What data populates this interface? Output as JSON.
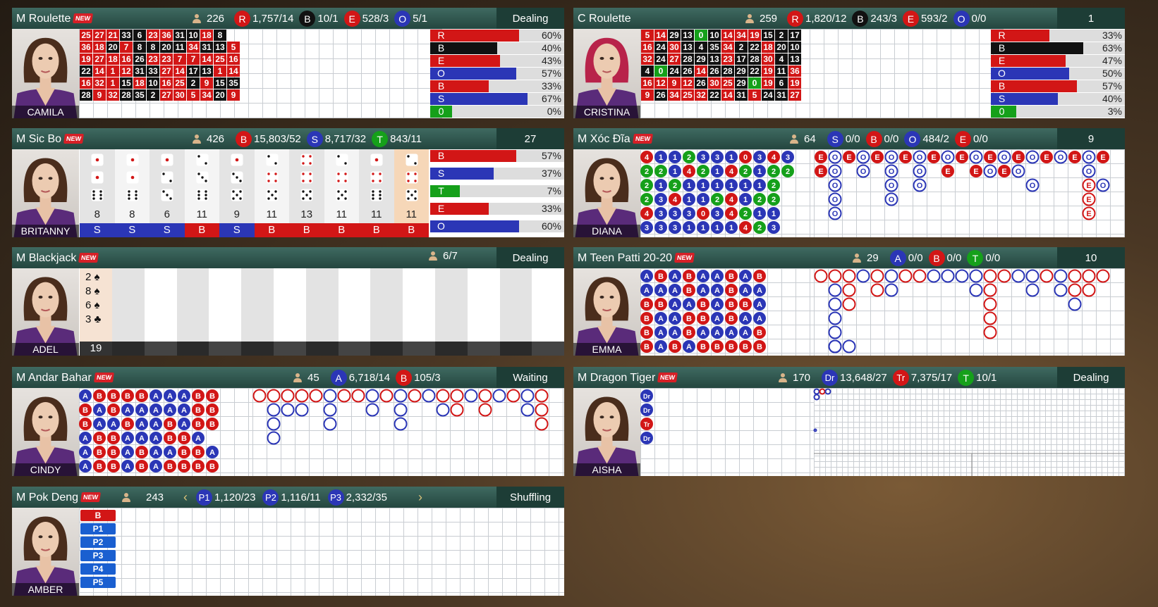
{
  "colors": {
    "red": "#d21616",
    "blue": "#2b36b6",
    "green": "#15a01a",
    "black": "#111111",
    "teal": "#2e5a52",
    "status_bg": "#1d3d36"
  },
  "roulette_m": {
    "title": "M Roulette",
    "new": "NEW",
    "players": "226",
    "badges": [
      {
        "l": "R",
        "v": "1,757/14",
        "c": "red"
      },
      {
        "l": "B",
        "v": "10/1",
        "c": "black"
      },
      {
        "l": "E",
        "v": "528/3",
        "c": "red"
      },
      {
        "l": "O",
        "v": "5/1",
        "c": "blue"
      }
    ],
    "status": "Dealing",
    "dealer": "CAMILA",
    "numbers": [
      [
        "25",
        "27",
        "21",
        "33",
        "6",
        "23",
        "36",
        "31",
        "10",
        "18",
        "8"
      ],
      [
        "36",
        "18",
        "20",
        "7",
        "8",
        "8",
        "20",
        "11",
        "34",
        "31",
        "13",
        "5"
      ],
      [
        "19",
        "27",
        "18",
        "16",
        "26",
        "23",
        "23",
        "7",
        "7",
        "14",
        "25",
        "16"
      ],
      [
        "22",
        "14",
        "1",
        "12",
        "31",
        "33",
        "27",
        "14",
        "17",
        "13",
        "1",
        "14"
      ],
      [
        "16",
        "32",
        "1",
        "15",
        "18",
        "10",
        "16",
        "25",
        "2",
        "9",
        "15",
        "35"
      ],
      [
        "28",
        "9",
        "32",
        "28",
        "35",
        "2",
        "27",
        "30",
        "5",
        "34",
        "20",
        "9"
      ]
    ],
    "bars": [
      {
        "l": "R",
        "p": "60%",
        "f": 60,
        "c": "red"
      },
      {
        "l": "B",
        "p": "40%",
        "f": 40,
        "c": "black"
      },
      {
        "l": "E",
        "p": "43%",
        "f": 43,
        "c": "red"
      },
      {
        "l": "O",
        "p": "57%",
        "f": 57,
        "c": "blue"
      },
      {
        "l": "B",
        "p": "33%",
        "f": 33,
        "c": "red"
      },
      {
        "l": "S",
        "p": "67%",
        "f": 67,
        "c": "blue"
      },
      {
        "l": "0",
        "p": "0%",
        "f": 0,
        "c": "green"
      }
    ]
  },
  "roulette_c": {
    "title": "C Roulette",
    "players": "259",
    "badges": [
      {
        "l": "R",
        "v": "1,820/12",
        "c": "red"
      },
      {
        "l": "B",
        "v": "243/3",
        "c": "black"
      },
      {
        "l": "E",
        "v": "593/2",
        "c": "red"
      },
      {
        "l": "O",
        "v": "0/0",
        "c": "blue"
      }
    ],
    "status": "1",
    "dealer": "CRISTINA",
    "numbers": [
      [
        "5",
        "14",
        "29",
        "13",
        "0",
        "10",
        "14",
        "34",
        "19",
        "15",
        "2",
        "17"
      ],
      [
        "16",
        "24",
        "30",
        "13",
        "4",
        "35",
        "34",
        "2",
        "22",
        "18",
        "20",
        "10"
      ],
      [
        "32",
        "24",
        "27",
        "28",
        "29",
        "13",
        "23",
        "17",
        "28",
        "30",
        "4",
        "13"
      ],
      [
        "4",
        "0",
        "24",
        "26",
        "14",
        "26",
        "28",
        "29",
        "22",
        "19",
        "11",
        "36"
      ],
      [
        "16",
        "12",
        "9",
        "12",
        "26",
        "30",
        "25",
        "29",
        "0",
        "19",
        "6",
        "19"
      ],
      [
        "9",
        "26",
        "34",
        "25",
        "32",
        "22",
        "14",
        "31",
        "5",
        "24",
        "31",
        "27"
      ]
    ],
    "bars": [
      {
        "l": "R",
        "p": "33%",
        "f": 33,
        "c": "red"
      },
      {
        "l": "B",
        "p": "63%",
        "f": 63,
        "c": "black"
      },
      {
        "l": "E",
        "p": "47%",
        "f": 47,
        "c": "red"
      },
      {
        "l": "O",
        "p": "50%",
        "f": 50,
        "c": "blue"
      },
      {
        "l": "B",
        "p": "57%",
        "f": 57,
        "c": "red"
      },
      {
        "l": "S",
        "p": "40%",
        "f": 40,
        "c": "blue"
      },
      {
        "l": "0",
        "p": "3%",
        "f": 3,
        "c": "green"
      }
    ]
  },
  "sicbo": {
    "title": "M Sic Bo",
    "new": "NEW",
    "players": "426",
    "badges": [
      {
        "l": "B",
        "v": "15,803/52",
        "c": "red"
      },
      {
        "l": "S",
        "v": "8,717/32",
        "c": "blue"
      },
      {
        "l": "T",
        "v": "843/11",
        "c": "green"
      }
    ],
    "status": "27",
    "dealer": "BRITANNY",
    "dice": [
      [
        1,
        1,
        6
      ],
      [
        1,
        1,
        6
      ],
      [
        1,
        2,
        3
      ],
      [
        2,
        3,
        6
      ],
      [
        1,
        3,
        5
      ],
      [
        2,
        4,
        5
      ],
      [
        4,
        4,
        5
      ],
      [
        2,
        4,
        5
      ],
      [
        1,
        4,
        6
      ],
      [
        2,
        4,
        5
      ]
    ],
    "totals": [
      "8",
      "8",
      "6",
      "11",
      "9",
      "11",
      "13",
      "11",
      "11",
      "11"
    ],
    "results": [
      "S",
      "S",
      "S",
      "B",
      "S",
      "B",
      "B",
      "B",
      "B",
      "B"
    ],
    "bars": [
      {
        "l": "B",
        "p": "57%",
        "f": 57,
        "c": "red"
      },
      {
        "l": "S",
        "p": "37%",
        "f": 37,
        "c": "blue"
      },
      {
        "l": "T",
        "p": "7%",
        "f": 7,
        "c": "green"
      },
      {
        "l": "E",
        "p": "33%",
        "f": 33,
        "c": "red"
      },
      {
        "l": "O",
        "p": "60%",
        "f": 60,
        "c": "blue"
      }
    ]
  },
  "xocdia": {
    "title": "M Xóc Đĩa",
    "new": "NEW",
    "players": "64",
    "badges": [
      {
        "l": "S",
        "v": "0/0",
        "c": "blue"
      },
      {
        "l": "B",
        "v": "0/0",
        "c": "red"
      },
      {
        "l": "O",
        "v": "484/2",
        "c": "blue"
      },
      {
        "l": "E",
        "v": "0/0",
        "c": "red"
      }
    ],
    "status": "9",
    "dealer": "DIANA",
    "bead": [
      [
        "4",
        "1",
        "1",
        "2",
        "3",
        "3",
        "1",
        "0",
        "3",
        "4",
        "3"
      ],
      [
        "2",
        "2",
        "1",
        "4",
        "2",
        "1",
        "4",
        "2",
        "1",
        "2",
        "2"
      ],
      [
        "2",
        "1",
        "2",
        "1",
        "1",
        "1",
        "1",
        "1",
        "1",
        "2"
      ],
      [
        "2",
        "3",
        "4",
        "1",
        "1",
        "2",
        "4",
        "1",
        "2",
        "2"
      ],
      [
        "4",
        "3",
        "3",
        "3",
        "0",
        "3",
        "4",
        "2",
        "1",
        "1"
      ],
      [
        "3",
        "3",
        "3",
        "1",
        "1",
        "1",
        "1",
        "4",
        "2",
        "3"
      ]
    ],
    "road": [
      [
        "E",
        "O",
        "E",
        "O",
        "E",
        "O",
        "E",
        "O",
        "E",
        "O",
        "E",
        "O",
        "E",
        "O",
        "E",
        "O",
        "E",
        "O",
        "E",
        "O",
        "E"
      ],
      [
        "E",
        "O",
        "",
        "O",
        "",
        "O",
        "",
        "O",
        "",
        "E",
        "",
        "E",
        "O",
        "E",
        "O",
        "",
        "",
        "",
        "",
        "O",
        ""
      ],
      [
        "",
        "O",
        "",
        "",
        "",
        "O",
        "",
        "O",
        "",
        "",
        "",
        "",
        "",
        "",
        "",
        "O",
        "",
        "",
        "",
        "E",
        "O"
      ],
      [
        "",
        "O",
        "",
        "",
        "",
        "O",
        "",
        "",
        "",
        "",
        "",
        "",
        "",
        "",
        "",
        "",
        "",
        "",
        "",
        "E",
        ""
      ],
      [
        "",
        "O",
        "",
        "",
        "",
        "",
        "",
        "",
        "",
        "",
        "",
        "",
        "",
        "",
        "",
        "",
        "",
        "",
        "",
        "E",
        ""
      ]
    ]
  },
  "blackjack": {
    "title": "M Blackjack",
    "new": "NEW",
    "players": "6/7",
    "status": "Dealing",
    "dealer": "ADEL",
    "cards": [
      "2 ♠",
      "8 ♠",
      "6 ♠",
      "3 ♣"
    ],
    "total": "19"
  },
  "teenpatti": {
    "title": "M Teen Patti 20-20",
    "new": "NEW",
    "players": "29",
    "badges": [
      {
        "l": "A",
        "v": "0/0",
        "c": "blue"
      },
      {
        "l": "B",
        "v": "0/0",
        "c": "red"
      },
      {
        "l": "T",
        "v": "0/0",
        "c": "green"
      }
    ],
    "status": "10",
    "dealer": "EMMA",
    "bead": [
      [
        "A",
        "B",
        "A",
        "B",
        "A",
        "A",
        "B",
        "A",
        "B"
      ],
      [
        "A",
        "A",
        "A",
        "B",
        "A",
        "A",
        "B",
        "A",
        "A"
      ],
      [
        "B",
        "B",
        "A",
        "A",
        "B",
        "A",
        "B",
        "B",
        "A"
      ],
      [
        "B",
        "A",
        "A",
        "B",
        "B",
        "A",
        "B",
        "A",
        "A"
      ],
      [
        "B",
        "A",
        "A",
        "B",
        "A",
        "A",
        "A",
        "A",
        "B"
      ],
      [
        "B",
        "A",
        "B",
        "A",
        "B",
        "B",
        "B",
        "B",
        "B"
      ]
    ]
  },
  "andarbahar": {
    "title": "M Andar Bahar",
    "new": "NEW",
    "players": "45",
    "badges": [
      {
        "l": "A",
        "v": "6,718/14",
        "c": "blue"
      },
      {
        "l": "B",
        "v": "105/3",
        "c": "red"
      }
    ],
    "status": "Waiting",
    "dealer": "CINDY",
    "bead": [
      [
        "A",
        "B",
        "B",
        "B",
        "B",
        "A",
        "A",
        "A",
        "B",
        "B"
      ],
      [
        "B",
        "A",
        "B",
        "A",
        "A",
        "A",
        "A",
        "A",
        "B",
        "B"
      ],
      [
        "B",
        "A",
        "A",
        "B",
        "A",
        "A",
        "B",
        "A",
        "B",
        "B"
      ],
      [
        "A",
        "B",
        "B",
        "A",
        "A",
        "A",
        "B",
        "B",
        "A"
      ],
      [
        "A",
        "B",
        "B",
        "A",
        "B",
        "A",
        "A",
        "B",
        "B",
        "A"
      ],
      [
        "A",
        "B",
        "B",
        "A",
        "B",
        "A",
        "B",
        "B",
        "B",
        "B"
      ]
    ]
  },
  "dragontiger": {
    "title": "M Dragon Tiger",
    "new": "NEW",
    "players": "170",
    "badges": [
      {
        "l": "Dr",
        "v": "13,648/27",
        "c": "blue"
      },
      {
        "l": "Tr",
        "v": "7,375/17",
        "c": "red"
      },
      {
        "l": "T",
        "v": "10/1",
        "c": "green"
      }
    ],
    "status": "Dealing",
    "dealer": "AISHA",
    "bead": [
      "Dr",
      "Dr",
      "Tr",
      "Dr"
    ]
  },
  "pokdeng": {
    "title": "M Pok Deng",
    "new": "NEW",
    "players": "243",
    "badges": [
      {
        "l": "P1",
        "v": "1,120/23",
        "c": "blue"
      },
      {
        "l": "P2",
        "v": "1,116/11",
        "c": "blue"
      },
      {
        "l": "P3",
        "v": "2,332/35",
        "c": "blue"
      }
    ],
    "status": "Shuffling",
    "dealer": "AMBER",
    "positions": [
      "B",
      "P1",
      "P2",
      "P3",
      "P4",
      "P5"
    ]
  }
}
